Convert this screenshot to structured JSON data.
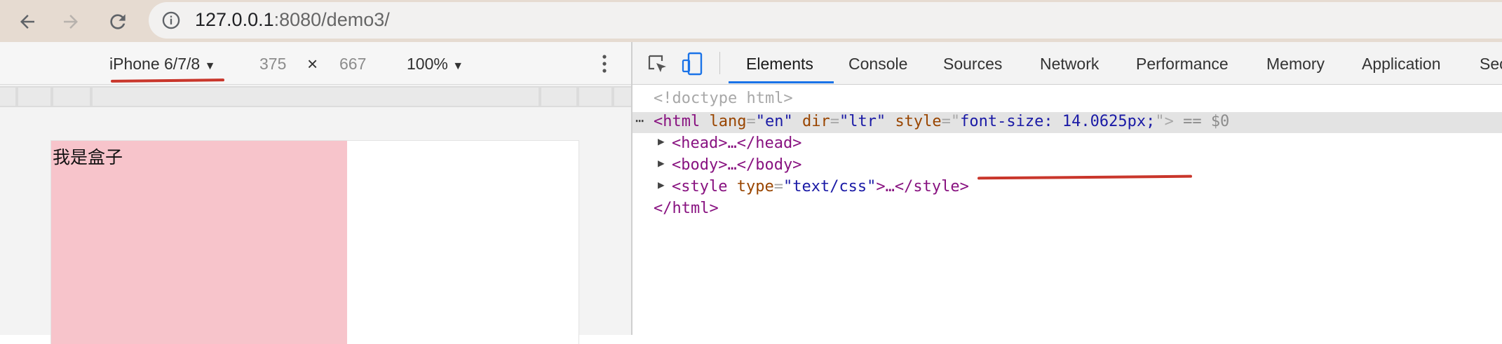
{
  "browser": {
    "url_host": "127.0.0.1",
    "url_rest": ":8080/demo3/"
  },
  "device_toolbar": {
    "device": "iPhone 6/7/8",
    "width": "375",
    "times": "×",
    "height": "667",
    "zoom": "100%"
  },
  "page": {
    "box_text": "我是盒子"
  },
  "devtools": {
    "tabs": [
      "Elements",
      "Console",
      "Sources",
      "Network",
      "Performance",
      "Memory",
      "Application",
      "Sec"
    ],
    "active_tab": "Elements",
    "dom": {
      "doctype": "<!doctype html>",
      "html_open_tag": "<html",
      "lang_attr": "lang",
      "lang_val": "\"en\"",
      "dir_attr": "dir",
      "dir_val": "\"ltr\"",
      "style_attr": "style",
      "style_val": "font-size: 14.0625px;",
      "console_ref": "== $0",
      "head": "<head>…</head>",
      "body": "<body>…</body>",
      "style_tag_open": "<style",
      "type_attr": "type",
      "type_val": "\"text/css\"",
      "style_tag_rest": ">…</style>",
      "html_close": "</html>"
    }
  },
  "colors": {
    "box_bg": "#f7c4cb",
    "annotation_red": "#c9362b",
    "active_tab_blue": "#1a73e8"
  }
}
